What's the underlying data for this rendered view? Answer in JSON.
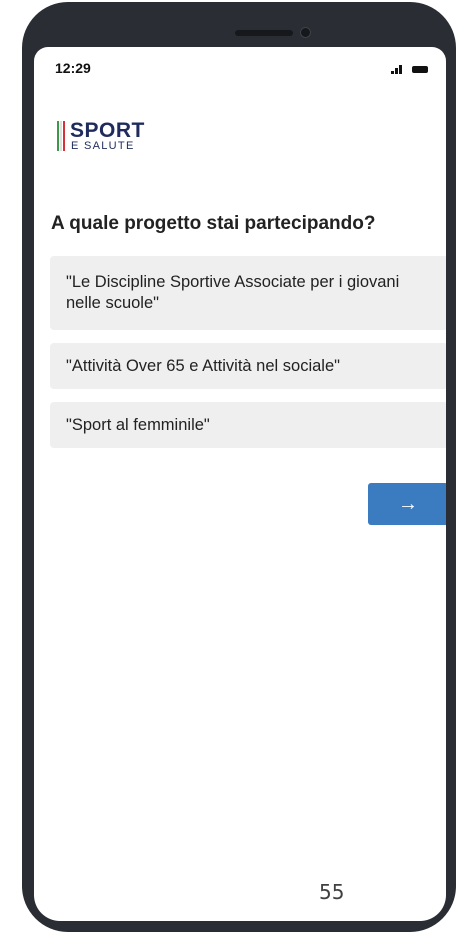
{
  "status_bar": {
    "time": "12:29",
    "signal_icon": "cellular-signal-icon",
    "battery_icon": "battery-icon"
  },
  "logo": {
    "line1": "SPORT",
    "line2": "E SALUTE",
    "stripe_colors": [
      "#3a9a4a",
      "#ffffff",
      "#d8303b"
    ]
  },
  "question": "A quale progetto stai partecipando?",
  "options": [
    "\"Le Discipline Sportive Associate per i giovani nelle scuole\"",
    "\"Attività Over 65 e Attività nel sociale\"",
    "\"Sport al femminile\""
  ],
  "next_button": {
    "label": "→",
    "color": "#3b7bbf"
  },
  "slide": {
    "page_number": "55"
  }
}
